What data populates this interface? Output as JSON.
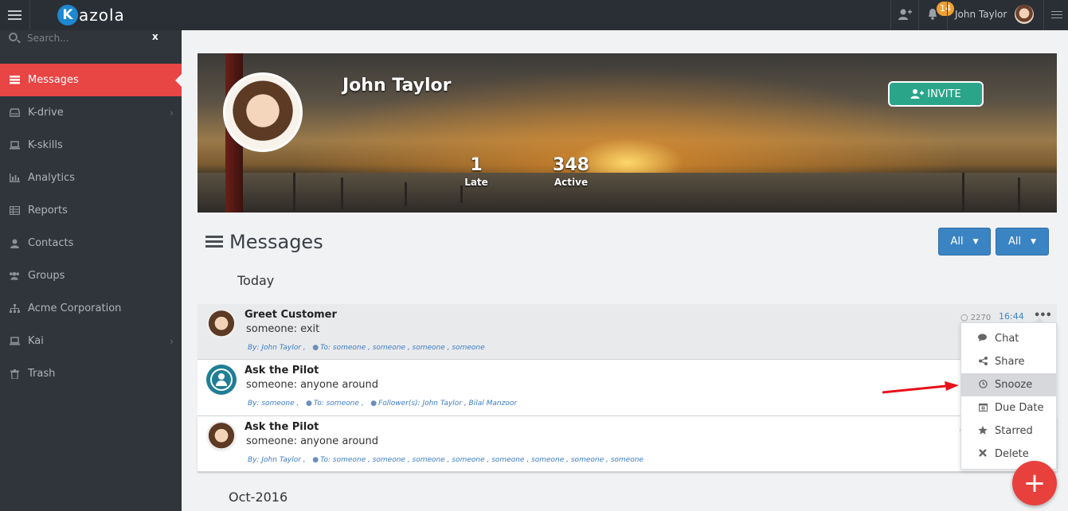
{
  "app": {
    "logo_letter": "K",
    "logo_text": "azola"
  },
  "topbar": {
    "notifications_count": "14",
    "user_name": "John Taylor"
  },
  "search": {
    "placeholder": "Search...",
    "clear": "x"
  },
  "sidebar": {
    "items": [
      {
        "label": "Messages",
        "icon": "messages-icon",
        "active": true
      },
      {
        "label": "K-drive",
        "icon": "drive-icon",
        "chevron": true
      },
      {
        "label": "K-skills",
        "icon": "laptop-icon"
      },
      {
        "label": "Analytics",
        "icon": "bar-chart-icon"
      },
      {
        "label": "Reports",
        "icon": "table-icon"
      },
      {
        "label": "Contacts",
        "icon": "user-icon"
      },
      {
        "label": "Groups",
        "icon": "group-icon"
      },
      {
        "label": "Acme Corporation",
        "icon": "sitemap-icon"
      },
      {
        "label": "Kai",
        "icon": "laptop-icon",
        "chevron": true
      },
      {
        "label": "Trash",
        "icon": "trash-icon"
      }
    ]
  },
  "profile": {
    "name": "John Taylor",
    "invite_label": "INVITE",
    "stats": [
      {
        "value": "1",
        "label": "Late"
      },
      {
        "value": "348",
        "label": "Active"
      }
    ]
  },
  "messages": {
    "title": "Messages",
    "filters": [
      "All",
      "All"
    ],
    "sections": [
      "Today",
      "Oct-2016"
    ],
    "items": [
      {
        "title": "Greet Customer",
        "body": "someone: exit",
        "by": "By:  John Taylor ,",
        "to": "To: someone , someone , someone , someone",
        "count": "2270",
        "time": "16:44",
        "more": "•••"
      },
      {
        "title": "Ask the Pilot",
        "body": "someone: anyone around",
        "by": "By:   someone ,",
        "to": "To: someone  ,",
        "followers": "Follower(s):  John Taylor , Bilal Manzoor"
      },
      {
        "title": "Ask the Pilot",
        "body": "someone: anyone around",
        "by": "By:  John Taylor ,",
        "to": "To: someone , someone , someone , someone , someone , someone , someone , someone"
      }
    ]
  },
  "menu": {
    "items": [
      {
        "label": "Chat",
        "icon": "comments-icon"
      },
      {
        "label": "Share",
        "icon": "share-icon"
      },
      {
        "label": "Snooze",
        "icon": "clock-icon",
        "highlighted": true
      },
      {
        "label": "Due Date",
        "icon": "calendar-icon"
      },
      {
        "label": "Starred",
        "icon": "star-icon"
      },
      {
        "label": "Delete",
        "icon": "delete-icon"
      }
    ]
  },
  "fab": {
    "label": "+"
  },
  "colors": {
    "accent": "#e84545",
    "invite": "#2aa58a",
    "filter": "#3b84c4",
    "sidebar": "#2f353b"
  }
}
